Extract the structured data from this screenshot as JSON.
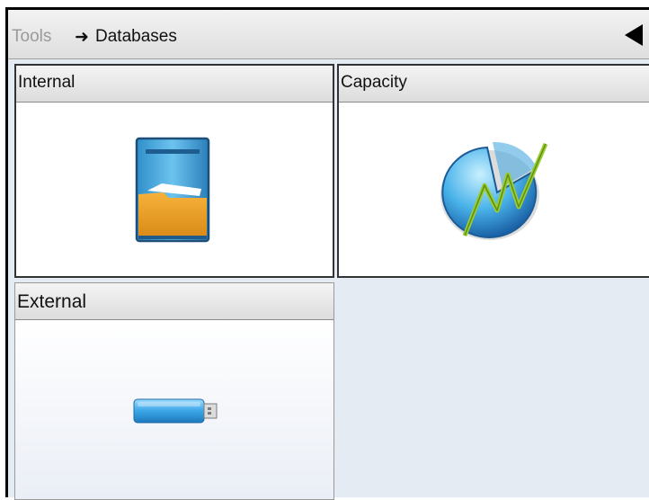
{
  "header": {
    "breadcrumb_root": "Tools",
    "breadcrumb_arrow": "➜",
    "breadcrumb_current": "Databases",
    "back_icon": "back-arrow-icon"
  },
  "tiles": [
    {
      "label": "Internal",
      "icon": "file-cabinet-icon"
    },
    {
      "label": "Capacity",
      "icon": "capacity-chart-icon"
    },
    {
      "label": "External",
      "icon": "usb-drive-icon"
    }
  ]
}
